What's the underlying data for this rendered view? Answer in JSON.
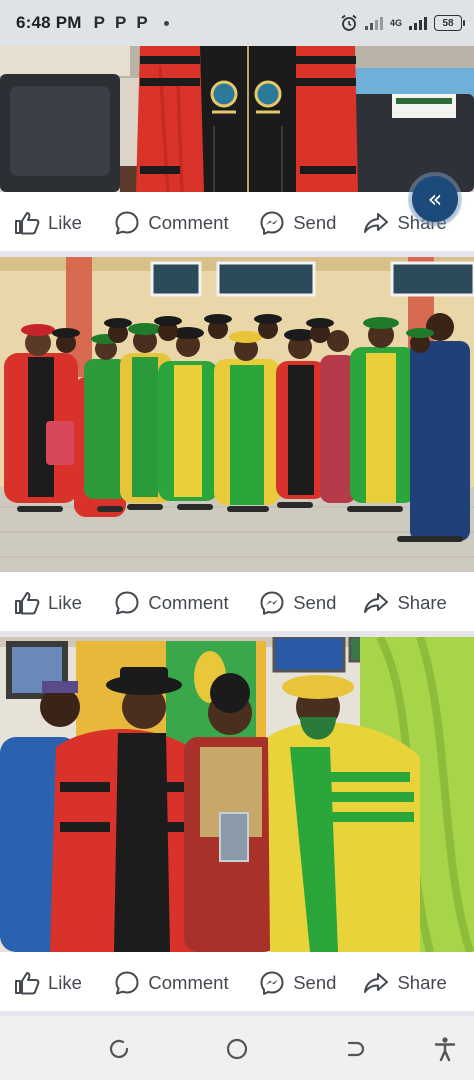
{
  "status_bar": {
    "time": "6:48 PM",
    "notification_icons": [
      "P",
      "P",
      "P"
    ],
    "network_label": "4G",
    "battery_level": "58",
    "icons": [
      "alarm-icon",
      "signal-icon",
      "signal-4g-icon",
      "battery-icon"
    ]
  },
  "posts": [
    {
      "photo_icon": "graduation-gown-closeup-photo",
      "actions": {
        "like": "Like",
        "comment": "Comment",
        "send": "Send",
        "share": "Share"
      }
    },
    {
      "photo_icon": "academic-group-photo",
      "actions": {
        "like": "Like",
        "comment": "Comment",
        "send": "Send",
        "share": "Share"
      }
    },
    {
      "photo_icon": "award-presentation-photo",
      "actions": {
        "like": "Like",
        "comment": "Comment",
        "send": "Send",
        "share": "Share"
      }
    }
  ],
  "floating_button": {
    "icon": "double-chevron-left-icon",
    "glyph": "«"
  },
  "nav_bar": {
    "icons": [
      "recent-apps-icon",
      "home-icon",
      "back-icon",
      "accessibility-icon"
    ]
  },
  "colors": {
    "accent": "#1c4a7a",
    "action_text": "#444950",
    "separator": "#e4e6eb"
  }
}
